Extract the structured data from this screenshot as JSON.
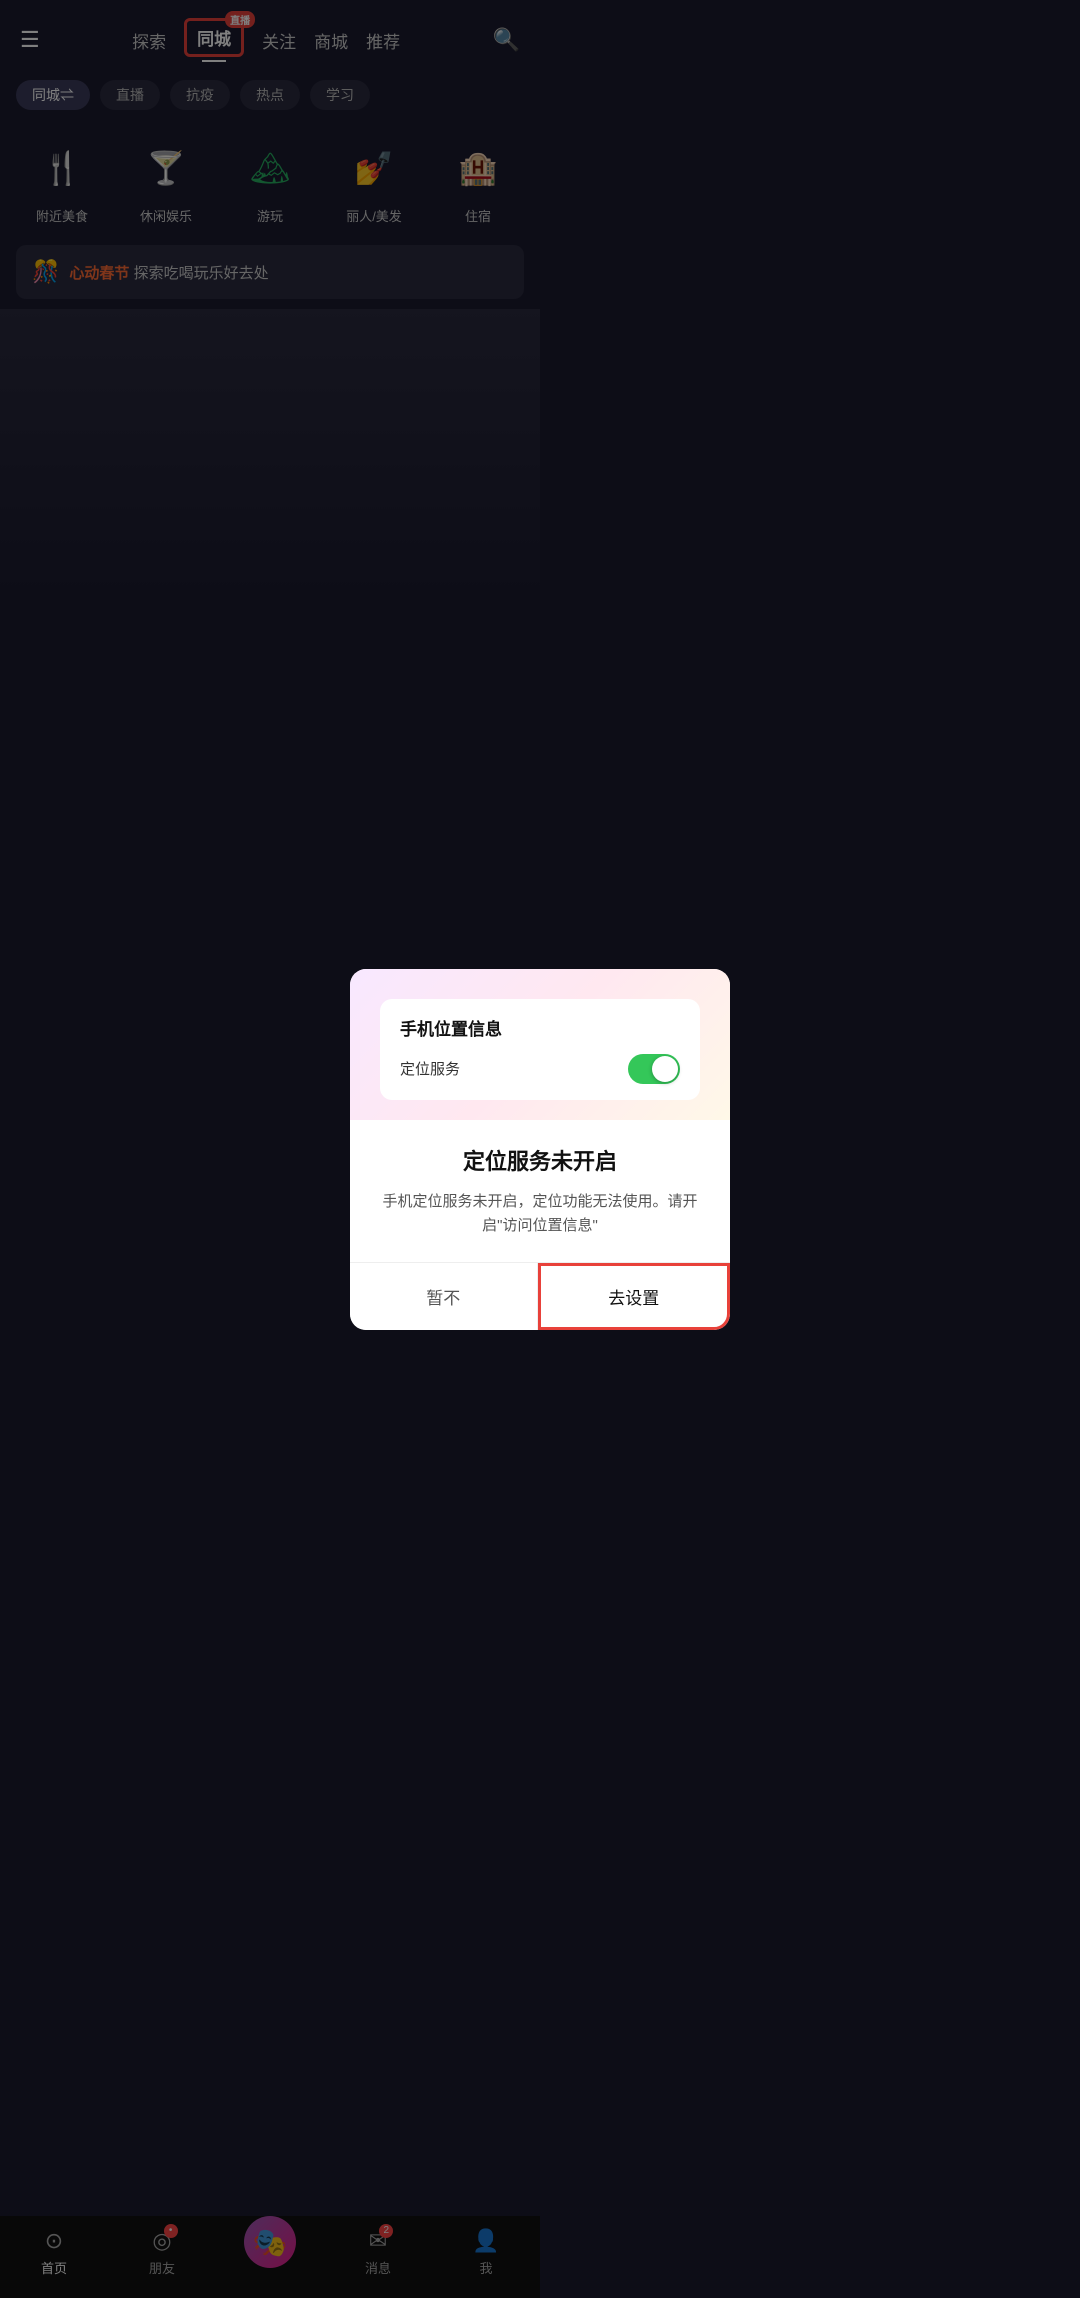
{
  "header": {
    "menu_icon": "☰",
    "tabs": [
      {
        "label": "探索",
        "active": false
      },
      {
        "label": "同城",
        "active": true,
        "selected": true
      },
      {
        "label": "关注",
        "active": false
      },
      {
        "label": "商城",
        "active": false
      },
      {
        "label": "推荐",
        "active": false
      }
    ],
    "live_badge": "直播",
    "search_icon": "🔍"
  },
  "filter_tabs": [
    {
      "label": "同城⇌",
      "active": true
    },
    {
      "label": "直播",
      "active": false
    },
    {
      "label": "抗疫",
      "active": false
    },
    {
      "label": "热点",
      "active": false
    },
    {
      "label": "学习",
      "active": false
    }
  ],
  "categories": [
    {
      "icon": "🍴",
      "label": "附近美食",
      "color": "#f0a500"
    },
    {
      "icon": "🍸",
      "label": "休闲娱乐",
      "color": "#9b59b6"
    },
    {
      "icon": "🏔",
      "label": "游玩",
      "color": "#27ae60"
    },
    {
      "icon": "💅",
      "label": "丽人/美发",
      "color": "#e91e8c"
    },
    {
      "icon": "🏨",
      "label": "住宿",
      "color": "#3498db"
    }
  ],
  "banner": {
    "icon": "🎊",
    "title": "心动春节",
    "subtitle": "探索吃喝玩乐好去处"
  },
  "dialog": {
    "settings_title": "手机位置信息",
    "location_label": "定位服务",
    "toggle_on": true,
    "dialog_title": "定位服务未开启",
    "dialog_desc": "手机定位服务未开启，定位功能无法使用。请开启\"访问位置信息\"",
    "cancel_label": "暂不",
    "confirm_label": "去设置"
  },
  "bottom_nav": {
    "items": [
      {
        "label": "首页",
        "active": true,
        "icon": "⊙"
      },
      {
        "label": "朋友",
        "active": false,
        "icon": "◎",
        "badge": "•"
      },
      {
        "label": "",
        "active": false,
        "is_center": true
      },
      {
        "label": "消息",
        "active": false,
        "icon": "✉",
        "badge": "2"
      },
      {
        "label": "我",
        "active": false,
        "icon": "👤"
      }
    ]
  }
}
